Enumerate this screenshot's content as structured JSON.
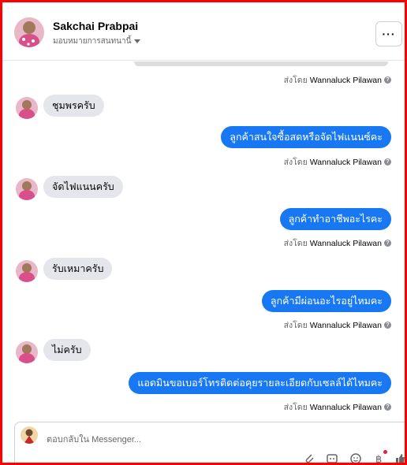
{
  "header": {
    "name": "Sakchai Prabpai",
    "subtitle": "มอบหมายการสนทนานี้",
    "more_label": "···"
  },
  "messages": [
    {
      "type": "sent_by",
      "prefix": "ส่งโดย",
      "sender": "Wannaluck Pilawan"
    },
    {
      "type": "incoming",
      "text": "ชุมพรครับ"
    },
    {
      "type": "outgoing",
      "text": "ลูกค้าสนใจซื้อสดหรือจัดไฟแนนซ์คะ"
    },
    {
      "type": "sent_by",
      "prefix": "ส่งโดย",
      "sender": "Wannaluck Pilawan"
    },
    {
      "type": "incoming",
      "text": "จัดไฟแนนครับ"
    },
    {
      "type": "outgoing",
      "text": "ลูกค้าทำอาชีพอะไรคะ"
    },
    {
      "type": "sent_by",
      "prefix": "ส่งโดย",
      "sender": "Wannaluck Pilawan"
    },
    {
      "type": "incoming",
      "text": "รับเหมาครับ"
    },
    {
      "type": "outgoing",
      "text": "ลูกค้ามีผ่อนอะไรอยู่ไหมคะ"
    },
    {
      "type": "sent_by",
      "prefix": "ส่งโดย",
      "sender": "Wannaluck Pilawan"
    },
    {
      "type": "incoming",
      "text": "ไม่ครับ"
    },
    {
      "type": "outgoing",
      "text": "แอดมินขอเบอร์โทรติดต่อคุยรายละเอียดกับเซลล์ได้ไหมคะ"
    },
    {
      "type": "sent_by",
      "prefix": "ส่งโดย",
      "sender": "Wannaluck Pilawan"
    }
  ],
  "composer": {
    "placeholder": "ตอบกลับใน Messenger..."
  },
  "icons": {
    "info": "info-icon",
    "attach": "paperclip-icon",
    "gif": "gif-icon",
    "emoji": "emoji-icon",
    "currency": "baht-icon",
    "like": "thumbs-up-icon"
  },
  "colors": {
    "outgoing_bubble": "#1877f2",
    "incoming_bubble": "#e4e6eb",
    "frame": "#ff0000"
  }
}
